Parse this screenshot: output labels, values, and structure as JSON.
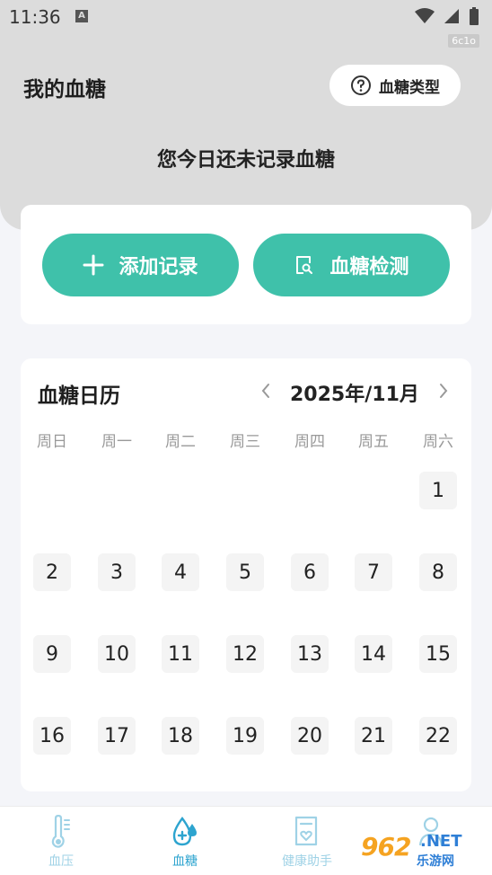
{
  "status_bar": {
    "time": "11:36",
    "a_badge": "A",
    "build_tag": "6c1o"
  },
  "header": {
    "title": "我的血糖",
    "type_button_label": "血糖类型",
    "today_message": "您今日还未记录血糖"
  },
  "actions": {
    "add_label": "添加记录",
    "detect_label": "血糖检测"
  },
  "calendar": {
    "title": "血糖日历",
    "month": "2025年/11月",
    "weekdays": [
      "周日",
      "周一",
      "周二",
      "周三",
      "周四",
      "周五",
      "周六"
    ],
    "days": [
      "1",
      "2",
      "3",
      "4",
      "5",
      "6",
      "7",
      "8",
      "9",
      "10",
      "11",
      "12",
      "13",
      "14",
      "15",
      "16",
      "17",
      "18",
      "19",
      "20",
      "21",
      "22"
    ]
  },
  "nav": {
    "items": [
      "血压",
      "血糖",
      "健康助手",
      ""
    ],
    "active": "血糖"
  },
  "watermark": {
    "logo": "962",
    "net": ".NET",
    "site": "乐游网"
  },
  "colors": {
    "header_bg": "#dcdcdc",
    "accent": "#3fc1aa",
    "nav_active": "#2da4cf",
    "nav_inactive": "#9fd2e6"
  },
  "icons": {
    "type_button": "question-circle-icon",
    "add": "plus-icon",
    "detect": "document-search-icon",
    "prev": "chevron-left-icon",
    "next": "chevron-right-icon",
    "nav": [
      "thermometer-icon",
      "blood-drop-icon",
      "heart-document-icon",
      "person-icon"
    ]
  }
}
